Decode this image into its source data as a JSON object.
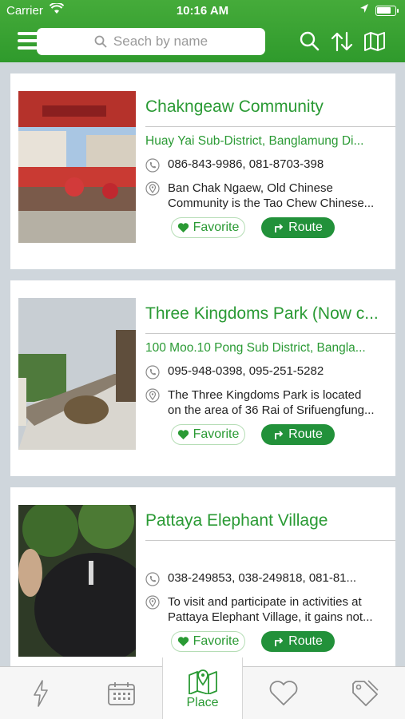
{
  "status_bar": {
    "carrier": "Carrier",
    "time": "10:16 AM"
  },
  "search": {
    "placeholder": "Seach by name"
  },
  "colors": {
    "brand_green": "#2f9a2c",
    "accent_green": "#2a9a34",
    "route_button": "#22913a"
  },
  "places": [
    {
      "title": "Chakngeaw Community",
      "address": "Huay Yai Sub-District, Banglamung Di...",
      "phone": "086-843-9986, 081-8703-398",
      "desc_line1": "Ban Chak Ngaew, Old Chinese",
      "desc_line2": "Community is the Tao Chew Chinese...",
      "favorite_label": "Favorite",
      "route_label": "Route"
    },
    {
      "title": "Three Kingdoms Park (Now c...",
      "address": "100 Moo.10 Pong Sub District, Bangla...",
      "phone": "095-948-0398, 095-251-5282",
      "desc_line1": "The Three Kingdoms Park is located",
      "desc_line2": "on the area of 36 Rai of Srifuengfung...",
      "favorite_label": "Favorite",
      "route_label": "Route"
    },
    {
      "title": "Pattaya Elephant Village",
      "address": "",
      "phone": "038-249853, 038-249818, 081-81...",
      "desc_line1": "To visit and participate in activities at",
      "desc_line2": "Pattaya Elephant Village, it gains not...",
      "favorite_label": "Favorite",
      "route_label": "Route"
    }
  ],
  "tab_bar": {
    "active_tab_label": "Place"
  }
}
